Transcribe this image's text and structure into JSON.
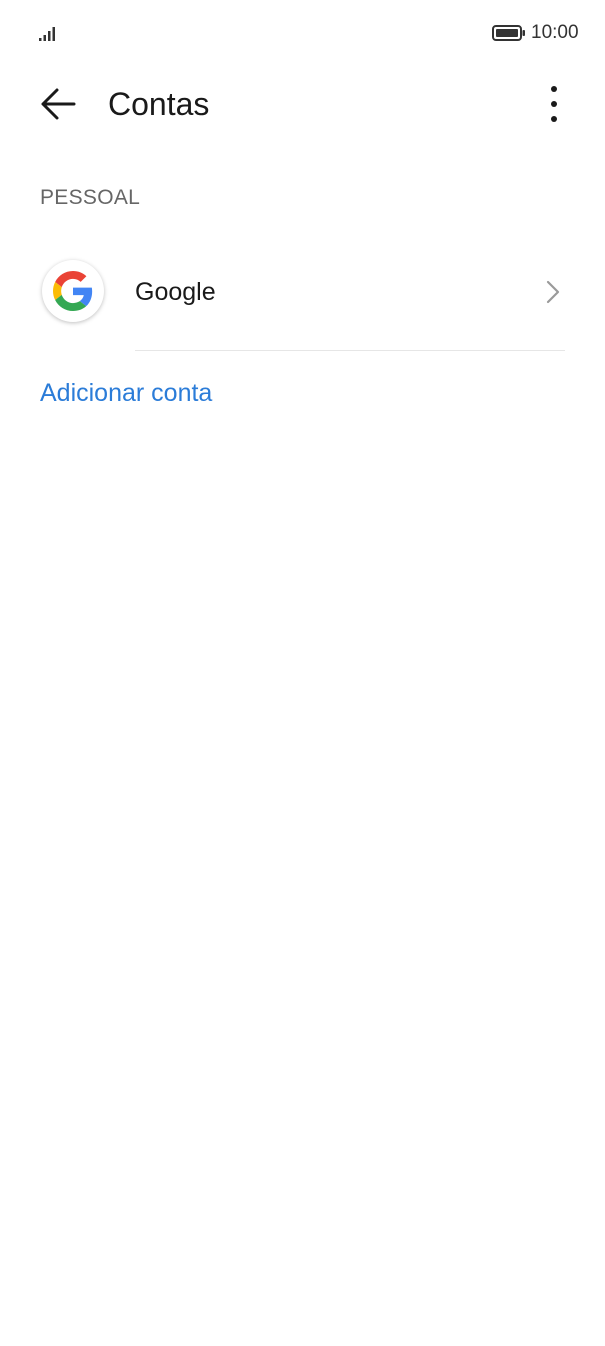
{
  "status_bar": {
    "time": "10:00",
    "signal_icon": "signal-bars-icon",
    "battery_icon": "battery-full-icon"
  },
  "app_bar": {
    "title": "Contas",
    "back_icon": "arrow-left-icon",
    "more_icon": "more-vertical-icon"
  },
  "section": {
    "header": "PESSOAL"
  },
  "accounts": [
    {
      "name": "Google",
      "icon": "google-logo-icon",
      "chevron_icon": "chevron-right-icon"
    }
  ],
  "actions": {
    "add_account": "Adicionar conta"
  },
  "colors": {
    "accent": "#2b7cd8",
    "google_blue": "#4285F4",
    "google_red": "#EA4335",
    "google_yellow": "#FBBC05",
    "google_green": "#34A853"
  }
}
